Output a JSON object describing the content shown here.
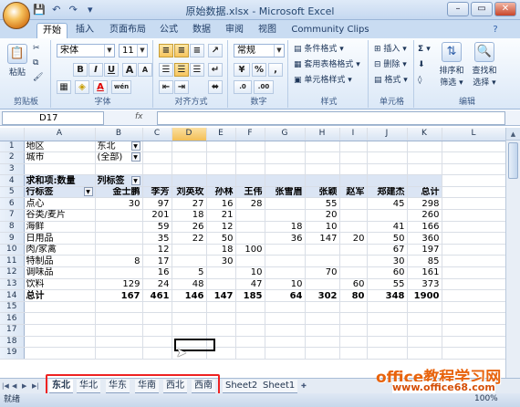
{
  "window": {
    "title": "原始数据.xlsx - Microsoft Excel",
    "controls": [
      "–",
      "▭",
      "✕"
    ]
  },
  "qat": [
    "💾",
    "↶",
    "↷",
    "▾"
  ],
  "tabs": [
    "开始",
    "插入",
    "页面布局",
    "公式",
    "数据",
    "审阅",
    "视图",
    "Community Clips"
  ],
  "ribbon": {
    "clipboard": {
      "label": "剪贴板",
      "paste": "粘贴"
    },
    "font": {
      "label": "字体",
      "name": "宋体",
      "size": "11",
      "bold": "B",
      "italic": "I",
      "underline": "U",
      "grow": "A",
      "shrink": "A",
      "wen": "wén"
    },
    "align": {
      "label": "对齐方式"
    },
    "number": {
      "label": "数字",
      "format": "常规",
      "pct": "%",
      "comma": ",",
      "inc": ".0",
      "dec": ".00"
    },
    "style": {
      "label": "样式",
      "cond": "条件格式 ▾",
      "table": "套用表格格式 ▾",
      "cell": "单元格样式 ▾"
    },
    "cells": {
      "label": "单元格",
      "insert": "插入 ▾",
      "delete": "删除 ▾",
      "format": "格式 ▾"
    },
    "edit": {
      "label": "编辑",
      "sum": "Σ ▾",
      "sort": "排序和",
      "sort2": "筛选 ▾",
      "find": "查找和",
      "find2": "选择 ▾"
    }
  },
  "formula_bar": {
    "name_box": "D17",
    "fx": "fx",
    "value": ""
  },
  "grid": {
    "columns": [
      "A",
      "B",
      "C",
      "D",
      "E",
      "F",
      "G",
      "H",
      "I",
      "J",
      "K",
      "L"
    ],
    "selected_column": "D",
    "rows": [
      [
        "1",
        "地区",
        "东北",
        "",
        "",
        "",
        "",
        "",
        "",
        "",
        "",
        "",
        ""
      ],
      [
        "2",
        "城市",
        "(全部)",
        "",
        "",
        "",
        "",
        "",
        "",
        "",
        "",
        "",
        ""
      ],
      [
        "3",
        "",
        "",
        "",
        "",
        "",
        "",
        "",
        "",
        "",
        "",
        "",
        ""
      ],
      [
        "4",
        "求和项:数量",
        "列标签",
        "",
        "",
        "",
        "",
        "",
        "",
        "",
        "",
        "",
        ""
      ],
      [
        "5",
        "行标签",
        "金士鹏",
        "李芳",
        "刘英玫",
        "孙林",
        "王伟",
        "张雪眉",
        "张颖",
        "赵军",
        "郑建杰",
        "总计",
        ""
      ],
      [
        "6",
        "点心",
        "30",
        "97",
        "27",
        "16",
        "28",
        "",
        "55",
        "",
        "45",
        "298",
        ""
      ],
      [
        "7",
        "谷类/麦片",
        "",
        "201",
        "18",
        "21",
        "",
        "",
        "20",
        "",
        "",
        "260",
        ""
      ],
      [
        "8",
        "海鲜",
        "",
        "59",
        "26",
        "12",
        "",
        "18",
        "10",
        "",
        "41",
        "166",
        ""
      ],
      [
        "9",
        "日用品",
        "",
        "35",
        "22",
        "50",
        "",
        "36",
        "147",
        "20",
        "50",
        "360",
        ""
      ],
      [
        "10",
        "肉/家禽",
        "",
        "12",
        "",
        "18",
        "100",
        "",
        "",
        "",
        "67",
        "197",
        ""
      ],
      [
        "11",
        "特制品",
        "8",
        "17",
        "",
        "30",
        "",
        "",
        "",
        "",
        "30",
        "85",
        ""
      ],
      [
        "12",
        "调味品",
        "",
        "16",
        "5",
        "",
        "10",
        "",
        "70",
        "",
        "60",
        "161",
        ""
      ],
      [
        "13",
        "饮料",
        "129",
        "24",
        "48",
        "",
        "47",
        "10",
        "",
        "60",
        "55",
        "373",
        ""
      ],
      [
        "14",
        "总计",
        "167",
        "461",
        "146",
        "147",
        "185",
        "64",
        "302",
        "80",
        "348",
        "1900",
        ""
      ],
      [
        "15",
        "",
        "",
        "",
        "",
        "",
        "",
        "",
        "",
        "",
        "",
        "",
        ""
      ],
      [
        "16",
        "",
        "",
        "",
        "",
        "",
        "",
        "",
        "",
        "",
        "",
        "",
        ""
      ],
      [
        "17",
        "",
        "",
        "",
        "",
        "",
        "",
        "",
        "",
        "",
        "",
        "",
        ""
      ],
      [
        "18",
        "",
        "",
        "",
        "",
        "",
        "",
        "",
        "",
        "",
        "",
        "",
        ""
      ],
      [
        "19",
        "",
        "",
        "",
        "",
        "",
        "",
        "",
        "",
        "",
        "",
        "",
        ""
      ]
    ]
  },
  "sheets": [
    "东北",
    "华北",
    "华东",
    "华南",
    "西北",
    "西南",
    "Sheet2",
    "Sheet1"
  ],
  "status": {
    "ready": "就绪",
    "zoom": "100%"
  },
  "watermark": {
    "line1": "office教程学习网",
    "line2": "www.office68.com"
  }
}
